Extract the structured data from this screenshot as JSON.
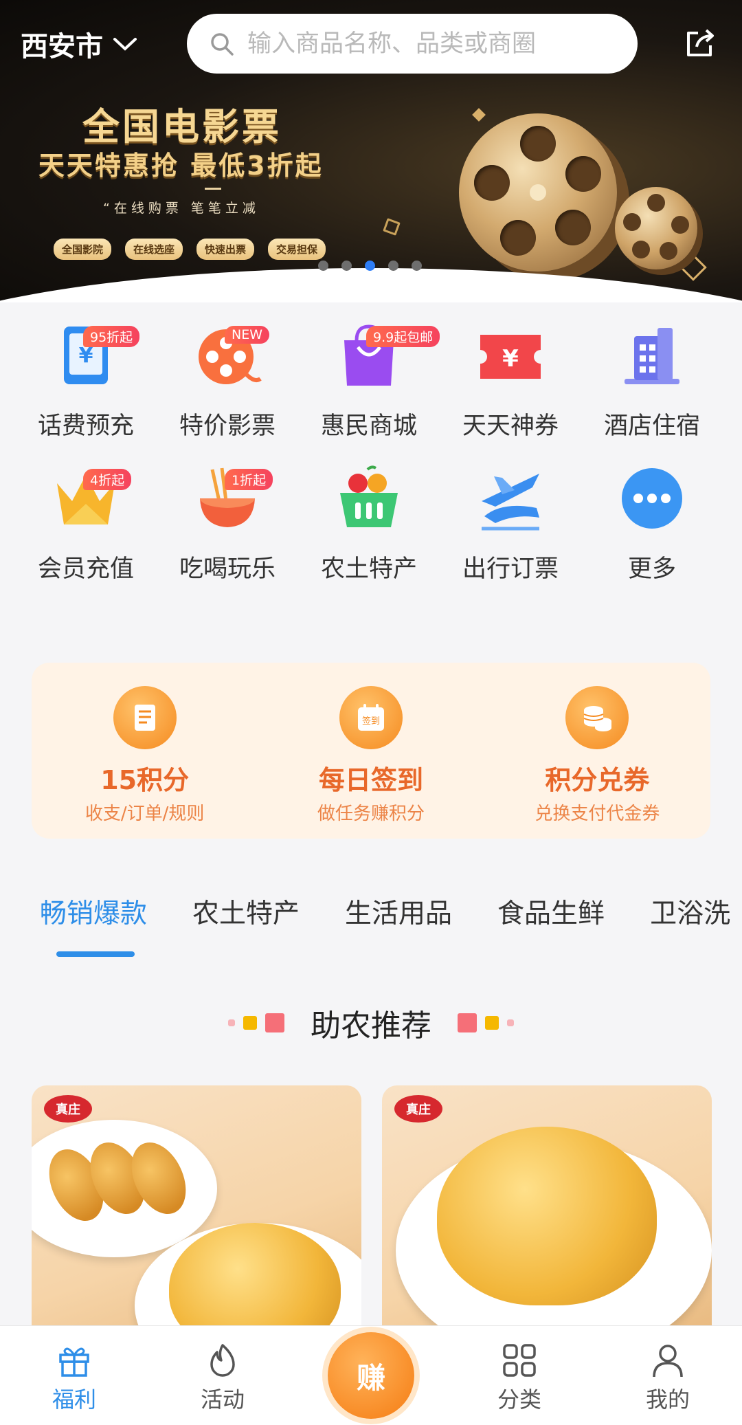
{
  "header": {
    "city": "西安市",
    "search_placeholder": "输入商品名称、品类或商圈"
  },
  "banner": {
    "headline": "全国电影票",
    "subline": "天天特惠抢  最低3折起",
    "slogan": "“在线购票  笔笔立减",
    "pills": [
      "全国影院",
      "在线选座",
      "快速出票",
      "交易担保"
    ],
    "pages": 5,
    "active_page": 3
  },
  "grid": [
    {
      "label": "话费预充",
      "badge": "95折起",
      "icon": "phone-recharge-icon"
    },
    {
      "label": "特价影票",
      "badge": "NEW",
      "icon": "film-reel-icon"
    },
    {
      "label": "惠民商城",
      "badge": "9.9起包邮",
      "icon": "shopping-bag-icon"
    },
    {
      "label": "天天神券",
      "badge": "",
      "icon": "coupon-icon"
    },
    {
      "label": "酒店住宿",
      "badge": "",
      "icon": "hotel-icon"
    },
    {
      "label": "会员充值",
      "badge": "4折起",
      "icon": "crown-icon"
    },
    {
      "label": "吃喝玩乐",
      "badge": "1折起",
      "icon": "noodle-bowl-icon"
    },
    {
      "label": "农土特产",
      "badge": "",
      "icon": "fruit-basket-icon"
    },
    {
      "label": "出行订票",
      "badge": "",
      "icon": "plane-train-icon"
    },
    {
      "label": "更多",
      "badge": "",
      "icon": "more-icon"
    }
  ],
  "points": [
    {
      "title": "15积分",
      "sub": "收支/订单/规则",
      "icon": "document-icon"
    },
    {
      "title": "每日签到",
      "sub": "做任务赚积分",
      "icon": "calendar-sign-icon",
      "icon_text": "签到"
    },
    {
      "title": "积分兑券",
      "sub": "兑换支付代金券",
      "icon": "coins-icon"
    }
  ],
  "tabs": [
    "畅销爆款",
    "农土特产",
    "生活用品",
    "食品生鲜",
    "卫浴洗"
  ],
  "active_tab": 0,
  "section_title": "助农推荐",
  "products": [
    {
      "brand": "真庄"
    },
    {
      "brand": "真庄"
    }
  ],
  "bottom_nav": [
    {
      "label": "福利",
      "icon": "gift-icon",
      "active": true
    },
    {
      "label": "活动",
      "icon": "flame-icon",
      "active": false
    },
    {
      "label": "赚",
      "icon": "earn-icon",
      "active": false
    },
    {
      "label": "分类",
      "icon": "grid-icon",
      "active": false
    },
    {
      "label": "我的",
      "icon": "user-icon",
      "active": false
    }
  ],
  "colors": {
    "accent": "#2e8ee8",
    "points_bg": "#fff3e6",
    "points_text": "#e8682a",
    "badge": "#f5425e"
  }
}
